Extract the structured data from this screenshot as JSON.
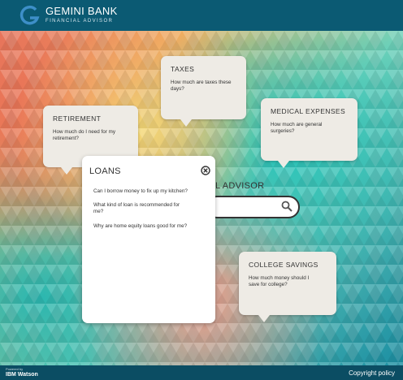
{
  "header": {
    "brand_title": "GEMINI BANK",
    "brand_subtitle": "FINANCIAL ADVISOR"
  },
  "bubbles": {
    "taxes": {
      "title": "TAXES",
      "text": "How much are taxes these days?"
    },
    "retirement": {
      "title": "RETIREMENT",
      "text": "How much do I need for my retirement?"
    },
    "medical": {
      "title": "MEDICAL EXPENSES",
      "text": "How much are general surgeries?"
    },
    "college": {
      "title": "COLLEGE SAVINGS",
      "text": "How much money should I save for college?"
    }
  },
  "search": {
    "label_visible": "L ADVISOR",
    "placeholder": ""
  },
  "loans_panel": {
    "title": "LOANS",
    "questions": [
      "Can I borrow money to fix up my kitchen?",
      "What kind of loan is recommended for me?",
      "Why are home equity loans good for me?"
    ]
  },
  "footer": {
    "powered_by": "Powered by",
    "watson": "IBM Watson",
    "copyright": "Copyright policy"
  },
  "colors": {
    "header": "#0b5a73",
    "footer": "#0b4d63",
    "bubble": "#eeebe5"
  }
}
